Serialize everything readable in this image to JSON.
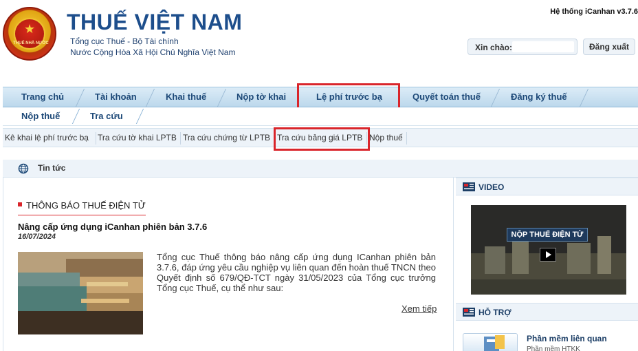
{
  "header": {
    "logo_text": "THUẾ NHÀ NƯỚC",
    "title": "THUẾ VIỆT NAM",
    "subtitle_1": "Tổng cục Thuế - Bộ Tài chính",
    "subtitle_2": "Nước Cộng Hòa Xã Hội Chủ Nghĩa Việt Nam",
    "system_version": "Hệ thống iCanhan v3.7.6",
    "greeting_label": "Xin chào:",
    "greeting_name": "",
    "logout_label": "Đăng xuất"
  },
  "main_nav": {
    "items": [
      "Trang chủ",
      "Tài khoản",
      "Khai thuế",
      "Nộp tờ khai",
      "Lệ phí trước bạ",
      "Quyết toán thuế",
      "Đăng ký thuế"
    ],
    "active": "Lệ phí trước bạ"
  },
  "sub_nav": {
    "items": [
      "Nộp thuế",
      "Tra cứu"
    ]
  },
  "menu_bar": {
    "items": [
      "Kê khai lệ phí trước bạ",
      "Tra cứu tờ khai LPTB",
      "Tra cứu chứng từ LPTB",
      "Tra cứu bảng giá LPTB",
      "Nộp thuế"
    ],
    "highlighted": "Tra cứu bảng giá LPTB"
  },
  "news": {
    "section_title": "Tin tức",
    "notice_title": "THÔNG BÁO THUẾ ĐIỆN TỬ",
    "article_title": "Nâng cấp ứng dụng iCanhan phiên bản 3.7.6",
    "article_date": "16/07/2024",
    "article_body": "Tổng cục Thuế thông báo nâng cấp ứng dụng ICanhan phiên bản 3.7.6, đáp ứng yêu cầu nghiệp vụ liên quan đến hoàn thuế TNCN theo Quyết định số 679/QĐ-TCT ngày 31/05/2023 của Tổng cục trưởng Tổng cục Thuế, cụ thể như sau:",
    "read_more": "Xem tiếp"
  },
  "sidebar": {
    "video_title": "VIDEO",
    "video_banner": "NỘP THUẾ ĐIỆN TỬ",
    "support_title": "HỖ TRỢ",
    "support_link": "Phần mềm liên quan",
    "support_sub": "Phần mềm HTKK"
  },
  "colors": {
    "brand_blue": "#1d4e8c",
    "highlight_red": "#d9252b",
    "nav_bg": "#bcd8ec"
  }
}
